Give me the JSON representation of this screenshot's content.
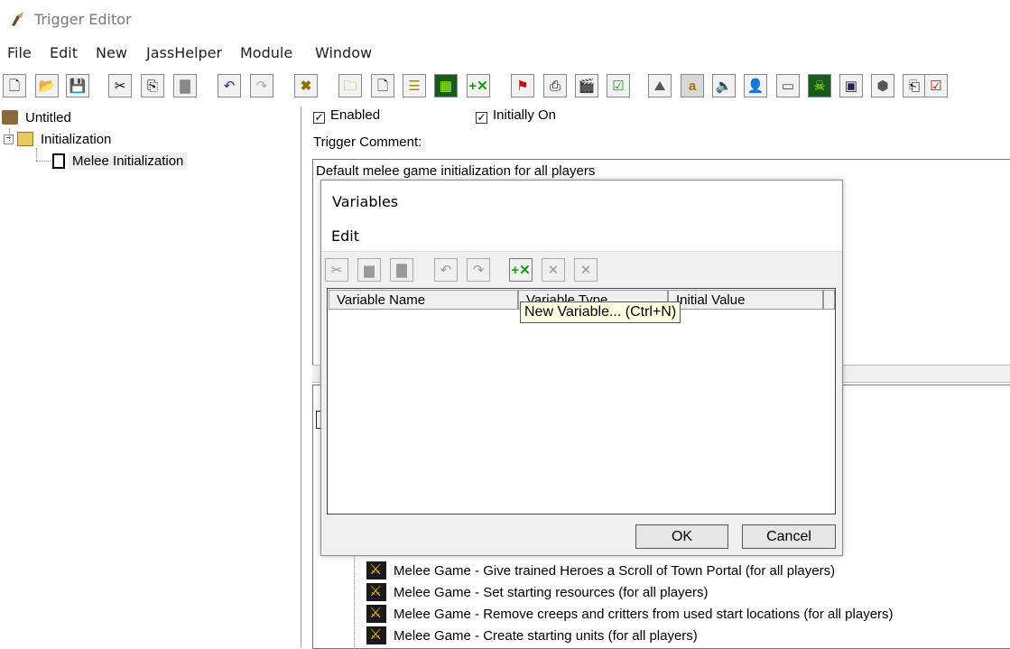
{
  "window": {
    "title": "Trigger Editor"
  },
  "menu": [
    "File",
    "Edit",
    "New",
    "JassHelper",
    "Module",
    "Window"
  ],
  "tree": {
    "root": "Untitled",
    "folder": "Initialization",
    "trigger": "Melee Initialization"
  },
  "trigger": {
    "enabled_label": "Enabled",
    "initially_on_label": "Initially On",
    "comment_label": "Trigger Comment:",
    "comment_text": "Default melee game initialization for all players",
    "actions": [
      "Melee Game - Give trained Heroes a Scroll of Town Portal (for all players)",
      "Melee Game - Set starting resources (for all players)",
      "Melee Game - Remove creeps and critters from used start locations (for all players)",
      "Melee Game - Create starting units (for all players)"
    ]
  },
  "dialog": {
    "title": "Variables",
    "menu": "Edit",
    "columns": [
      "Variable Name",
      "Variable Type",
      "Initial Value"
    ],
    "tooltip": "New Variable... (Ctrl+N)",
    "ok": "OK",
    "cancel": "Cancel"
  },
  "colors": {
    "accent_green": "#1a9a1a",
    "tooltip_bg": "#ffffe1"
  }
}
